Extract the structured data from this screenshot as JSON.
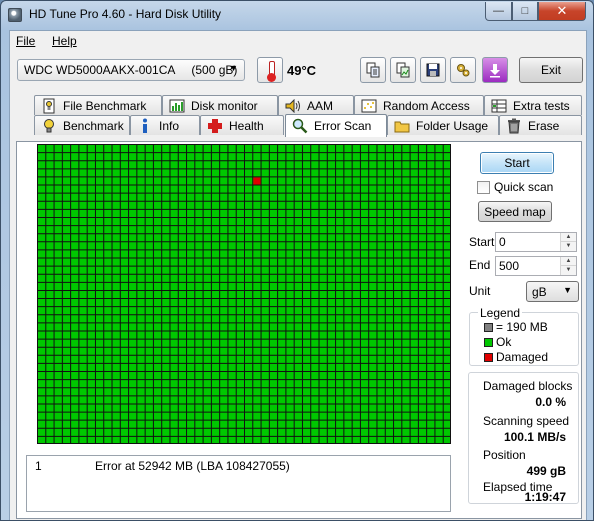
{
  "window": {
    "title": "HD Tune Pro 4.60 - Hard Disk Utility"
  },
  "menu": {
    "file": "File",
    "help": "Help"
  },
  "toolbar": {
    "drive": "WDC WD5000AAKX-001CA     (500 gB)",
    "temperature": "49°C",
    "exit_label": "Exit"
  },
  "tabs_top": [
    {
      "label": "File Benchmark",
      "icon": "file-benchmark-icon"
    },
    {
      "label": "Disk monitor",
      "icon": "disk-monitor-icon"
    },
    {
      "label": "AAM",
      "icon": "speaker-icon"
    },
    {
      "label": "Random Access",
      "icon": "random-access-icon"
    },
    {
      "label": "Extra tests",
      "icon": "extra-tests-icon"
    }
  ],
  "tabs_bottom": [
    {
      "label": "Benchmark",
      "icon": "lightbulb-icon"
    },
    {
      "label": "Info",
      "icon": "info-icon"
    },
    {
      "label": "Health",
      "icon": "health-cross-icon"
    },
    {
      "label": "Error Scan",
      "icon": "magnifier-icon",
      "active": true
    },
    {
      "label": "Folder Usage",
      "icon": "folder-icon"
    },
    {
      "label": "Erase",
      "icon": "trash-icon"
    }
  ],
  "scan": {
    "start_label": "Start",
    "quick_scan_label": "Quick scan",
    "speed_map_label": "Speed map",
    "start_field_label": "Start",
    "start_value": "0",
    "end_field_label": "End",
    "end_value": "500",
    "unit_label": "Unit",
    "unit_value": "gB"
  },
  "grid": {
    "columns": 50,
    "rows": 37,
    "ok_color": "#00c800",
    "damaged_color": "#e00000",
    "line_color": "#111111",
    "damaged_blocks": [
      {
        "col": 26,
        "row": 4
      }
    ]
  },
  "legend": {
    "title": "Legend",
    "block_size": "= 190 MB",
    "ok": "Ok",
    "damaged": "Damaged",
    "block_color": "#808080",
    "ok_color": "#00c800",
    "damaged_color": "#e00000"
  },
  "stats": {
    "damaged_blocks_label": "Damaged blocks",
    "damaged_blocks_value": "0.0 %",
    "scanning_speed_label": "Scanning speed",
    "scanning_speed_value": "100.1 MB/s",
    "position_label": "Position",
    "position_value": "499 gB",
    "elapsed_label": "Elapsed time",
    "elapsed_value": "1:19:47"
  },
  "log": [
    {
      "index": "1",
      "message": "Error at 52942 MB (LBA 108427055)"
    }
  ]
}
